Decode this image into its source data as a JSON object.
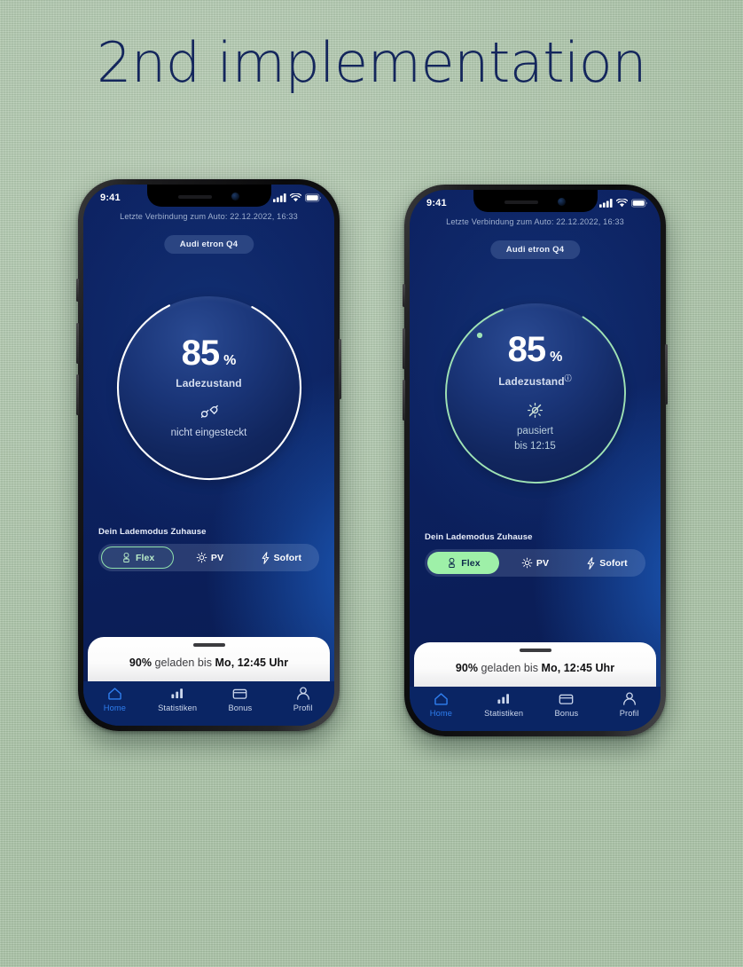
{
  "page": {
    "headline": "2nd implementation",
    "background_color": "#a9c3a6",
    "headline_color": "#14265c"
  },
  "phones": [
    {
      "id": "phone-1",
      "variant": "outline-selection",
      "statusbar": {
        "time": "9:41",
        "cellular_icon": "cellular-bars-icon",
        "wifi_icon": "wifi-icon",
        "battery_icon": "battery-icon"
      },
      "last_connection": "Letzte Verbindung zum Auto: 22.12.2022, 16:33",
      "car_chip": "Audi etron Q4",
      "gauge": {
        "value": "85",
        "unit": "%",
        "label": "Ladezustand",
        "has_info_icon": false,
        "info_glyph": "",
        "state_icon": "plug-disconnected-icon",
        "status_line_1": "nicht eingesteckt",
        "status_line_2": "",
        "arc_color": "#ffffff",
        "arc_percent": 85,
        "track_visible": false,
        "marker_dot": false
      },
      "mode": {
        "title": "Dein Lademodus Zuhause",
        "items": [
          {
            "label": "Flex",
            "icon": "plug-flex-icon",
            "selected": true,
            "style": "outline"
          },
          {
            "label": "PV",
            "icon": "sun-icon",
            "selected": false,
            "style": "plain"
          },
          {
            "label": "Sofort",
            "icon": "bolt-icon",
            "selected": false,
            "style": "plain"
          }
        ]
      },
      "sheet": {
        "grabber": "sheet-grabber",
        "prefix": "90%",
        "middle": " geladen bis ",
        "suffix": "Mo, 12:45 Uhr"
      },
      "tabs": [
        {
          "label": "Home",
          "icon": "home-icon",
          "active": true
        },
        {
          "label": "Statistiken",
          "icon": "bar-chart-icon",
          "active": false
        },
        {
          "label": "Bonus",
          "icon": "wallet-icon",
          "active": false
        },
        {
          "label": "Profil",
          "icon": "person-icon",
          "active": false
        }
      ]
    },
    {
      "id": "phone-2",
      "variant": "filled-selection",
      "statusbar": {
        "time": "9:41",
        "cellular_icon": "cellular-bars-icon",
        "wifi_icon": "wifi-icon",
        "battery_icon": "battery-icon"
      },
      "last_connection": "Letzte Verbindung zum Auto: 22.12.2022, 16:33",
      "car_chip": "Audi etron Q4",
      "gauge": {
        "value": "85",
        "unit": "%",
        "label": "Ladezustand",
        "has_info_icon": true,
        "info_glyph": "ⓘ",
        "state_icon": "sun-paused-icon",
        "status_line_1": "pausiert",
        "status_line_2": "bis 12:15",
        "arc_color": "#9fe3b5",
        "arc_percent": 85,
        "track_visible": false,
        "marker_dot": true
      },
      "mode": {
        "title": "Dein Lademodus Zuhause",
        "items": [
          {
            "label": "Flex",
            "icon": "plug-flex-icon",
            "selected": true,
            "style": "filled"
          },
          {
            "label": "PV",
            "icon": "sun-icon",
            "selected": false,
            "style": "plain"
          },
          {
            "label": "Sofort",
            "icon": "bolt-icon",
            "selected": false,
            "style": "plain"
          }
        ]
      },
      "sheet": {
        "grabber": "sheet-grabber",
        "prefix": "90%",
        "middle": " geladen bis ",
        "suffix": "Mo, 12:45 Uhr"
      },
      "tabs": [
        {
          "label": "Home",
          "icon": "home-icon",
          "active": true
        },
        {
          "label": "Statistiken",
          "icon": "bar-chart-icon",
          "active": false
        },
        {
          "label": "Bonus",
          "icon": "wallet-icon",
          "active": false
        },
        {
          "label": "Profil",
          "icon": "person-icon",
          "active": false
        }
      ]
    }
  ]
}
